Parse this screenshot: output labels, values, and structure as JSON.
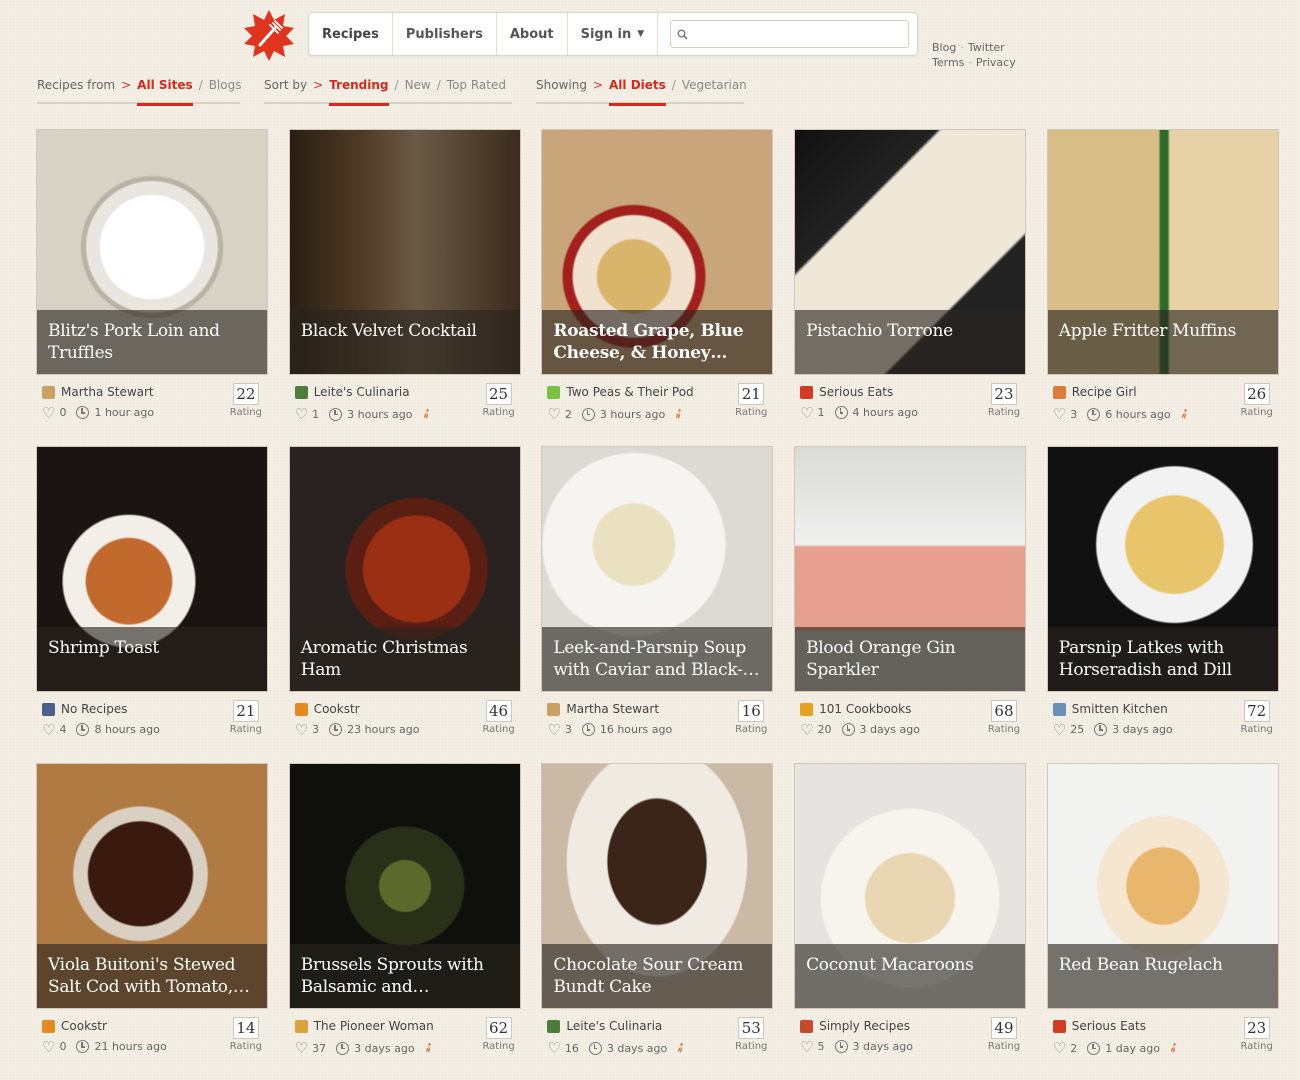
{
  "nav": {
    "items": [
      "Recipes",
      "Publishers",
      "About",
      "Sign in"
    ],
    "search_placeholder": ""
  },
  "side_links": {
    "blog": "Blog",
    "twitter": "Twitter",
    "terms": "Terms",
    "privacy": "Privacy"
  },
  "filters": {
    "source": {
      "label": "Recipes from",
      "options": [
        "All Sites",
        "Blogs"
      ],
      "active": "All Sites"
    },
    "sort": {
      "label": "Sort by",
      "options": [
        "Trending",
        "New",
        "Top Rated"
      ],
      "active": "Trending"
    },
    "diet": {
      "label": "Showing",
      "options": [
        "All Diets",
        "Vegetarian"
      ],
      "active": "All Diets"
    }
  },
  "rating_label": "Rating",
  "colors": {
    "accent": "#d42a1e",
    "background": "#f4efe4"
  },
  "recipes": [
    {
      "title": "Blitz's Pork Loin and Truffles",
      "publisher": "Martha Stewart",
      "likes": "0",
      "time": "1 hour ago",
      "rating": "22",
      "veg": false,
      "bold": false
    },
    {
      "title": "Black Velvet Cocktail",
      "publisher": "Leite's Culinaria",
      "likes": "1",
      "time": "3 hours ago",
      "rating": "25",
      "veg": true,
      "bold": false
    },
    {
      "title": "Roasted Grape, Blue Cheese, & Honey…",
      "publisher": "Two Peas & Their Pod",
      "likes": "2",
      "time": "3 hours ago",
      "rating": "21",
      "veg": true,
      "bold": true
    },
    {
      "title": "Pistachio Torrone",
      "publisher": "Serious Eats",
      "likes": "1",
      "time": "4 hours ago",
      "rating": "23",
      "veg": false,
      "bold": false
    },
    {
      "title": "Apple Fritter Muffins",
      "publisher": "Recipe Girl",
      "likes": "3",
      "time": "6 hours ago",
      "rating": "26",
      "veg": true,
      "bold": false
    },
    {
      "title": "Shrimp Toast",
      "publisher": "No Recipes",
      "likes": "4",
      "time": "8 hours ago",
      "rating": "21",
      "veg": false,
      "bold": false
    },
    {
      "title": "Aromatic Christmas Ham",
      "publisher": "Cookstr",
      "likes": "3",
      "time": "23 hours ago",
      "rating": "46",
      "veg": false,
      "bold": false
    },
    {
      "title": "Leek-and-Parsnip Soup with Caviar and Black-…",
      "publisher": "Martha Stewart",
      "likes": "3",
      "time": "16 hours ago",
      "rating": "16",
      "veg": false,
      "bold": false
    },
    {
      "title": "Blood Orange Gin Sparkler",
      "publisher": "101 Cookbooks",
      "likes": "20",
      "time": "3 days ago",
      "rating": "68",
      "veg": false,
      "bold": false
    },
    {
      "title": "Parsnip Latkes with Horseradish and Dill",
      "publisher": "Smitten Kitchen",
      "likes": "25",
      "time": "3 days ago",
      "rating": "72",
      "veg": false,
      "bold": false
    },
    {
      "title": "Viola Buitoni's Stewed Salt Cod with Tomato,…",
      "publisher": "Cookstr",
      "likes": "0",
      "time": "21 hours ago",
      "rating": "14",
      "veg": false,
      "bold": false
    },
    {
      "title": "Brussels Sprouts with Balsamic and…",
      "publisher": "The Pioneer Woman",
      "likes": "37",
      "time": "3 days ago",
      "rating": "62",
      "veg": true,
      "bold": false
    },
    {
      "title": "Chocolate Sour Cream Bundt Cake",
      "publisher": "Leite's Culinaria",
      "likes": "16",
      "time": "3 days ago",
      "rating": "53",
      "veg": true,
      "bold": false
    },
    {
      "title": "Coconut Macaroons",
      "publisher": "Simply Recipes",
      "likes": "5",
      "time": "3 days ago",
      "rating": "49",
      "veg": false,
      "bold": false
    },
    {
      "title": "Red Bean Rugelach",
      "publisher": "Serious Eats",
      "likes": "2",
      "time": "1 day ago",
      "rating": "23",
      "veg": true,
      "bold": false
    }
  ]
}
